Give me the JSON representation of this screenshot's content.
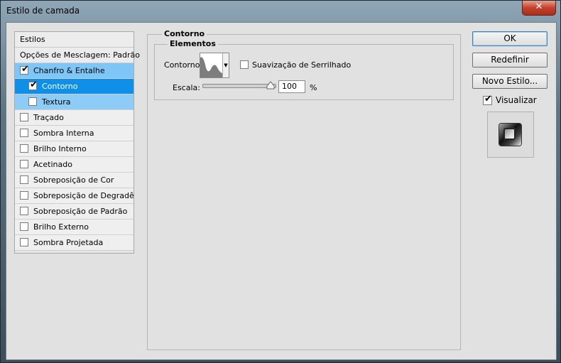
{
  "window": {
    "title": "Estilo de camada",
    "close_symbol": "✕"
  },
  "styles": {
    "header": "Estilos",
    "blend_options": "Opções de Mesclagem: Padrão",
    "items": [
      {
        "label": "Chanfro & Entalhe",
        "checked": true
      },
      {
        "label": "Contorno",
        "checked": true
      },
      {
        "label": "Textura",
        "checked": false
      },
      {
        "label": "Traçado",
        "checked": false
      },
      {
        "label": "Sombra Interna",
        "checked": false
      },
      {
        "label": "Brilho Interno",
        "checked": false
      },
      {
        "label": "Acetinado",
        "checked": false
      },
      {
        "label": "Sobreposição de Cor",
        "checked": false
      },
      {
        "label": "Sobreposição de Degradê",
        "checked": false
      },
      {
        "label": "Sobreposição de Padrão",
        "checked": false
      },
      {
        "label": "Brilho Externo",
        "checked": false
      },
      {
        "label": "Sombra Projetada",
        "checked": false
      }
    ]
  },
  "contour_section": {
    "title": "Contorno",
    "elements_title": "Elementos",
    "contour_label": "Contorno:",
    "antialias_label": "Suavização de Serrilhado",
    "antialias_checked": false,
    "scale_label": "Escala:",
    "scale_value": "100",
    "scale_unit": "%",
    "scale_fraction": 1.0
  },
  "buttons": {
    "ok": "OK",
    "reset": "Redefinir",
    "new_style": "Novo Estilo..."
  },
  "preview": {
    "label": "Visualizar",
    "checked": true
  },
  "colors": {
    "selected_row": "#0f8fe8",
    "highlight_row": "#7ec6f5",
    "dialog_bg": "#e1e1e1"
  }
}
